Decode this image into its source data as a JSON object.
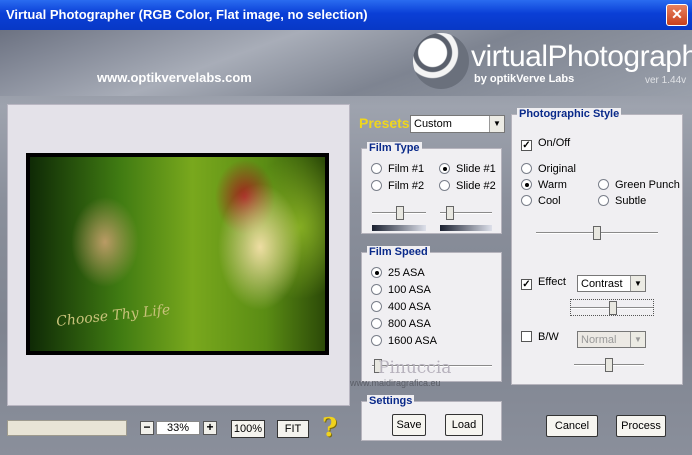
{
  "window": {
    "title": "Virtual Photographer (RGB Color, Flat image, no selection)",
    "close_label": "✕"
  },
  "header": {
    "website": "www.optikvervelabs.com",
    "logo_text": "virtualPhotographer",
    "logo_sub": "by optikVerve Labs",
    "version": "ver 1.44v"
  },
  "preview": {
    "overlay_text": "Choose Thy Life"
  },
  "zoom": {
    "minus": "−",
    "value": "33%",
    "plus": "+",
    "full_label": "100%",
    "fit_label": "FIT",
    "help": "?"
  },
  "presets": {
    "label": "Presets",
    "value": "Custom"
  },
  "film_type": {
    "title": "Film Type",
    "options": [
      {
        "label": "Film #1",
        "selected": false
      },
      {
        "label": "Slide #1",
        "selected": true
      },
      {
        "label": "Film #2",
        "selected": false
      },
      {
        "label": "Slide #2",
        "selected": false
      }
    ]
  },
  "film_speed": {
    "title": "Film Speed",
    "options": [
      {
        "label": "25 ASA",
        "selected": true
      },
      {
        "label": "100 ASA",
        "selected": false
      },
      {
        "label": "400 ASA",
        "selected": false
      },
      {
        "label": "800 ASA",
        "selected": false
      },
      {
        "label": "1600 ASA",
        "selected": false
      }
    ]
  },
  "photographic_style": {
    "title": "Photographic Style",
    "onoff_label": "On/Off",
    "onoff_checked": true,
    "options": [
      {
        "label": "Original",
        "selected": false
      },
      {
        "label": "Warm",
        "selected": true
      },
      {
        "label": "Green Punch",
        "selected": false
      },
      {
        "label": "Cool",
        "selected": false
      },
      {
        "label": "Subtle",
        "selected": false
      }
    ],
    "effect_label": "Effect",
    "effect_checked": true,
    "effect_value": "Contrast",
    "bw_label": "B/W",
    "bw_checked": false,
    "bw_value": "Normal"
  },
  "settings": {
    "title": "Settings",
    "save_label": "Save",
    "load_label": "Load"
  },
  "actions": {
    "cancel_label": "Cancel",
    "process_label": "Process"
  },
  "watermark": {
    "name": "Pinuccia",
    "url": "www.maidiragrafica.eu"
  },
  "icons": [
    "close-icon",
    "help-icon",
    "dropdown-arrow-icon",
    "logo-ring-icon"
  ]
}
